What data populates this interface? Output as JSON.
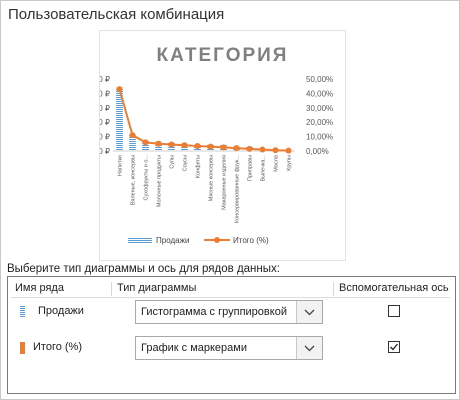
{
  "dialog": {
    "title": "Пользовательская комбинация",
    "instruction": "Выберите тип диаграммы и ось для рядов данных:"
  },
  "chart_data": {
    "type": "bar",
    "title": "КАТЕГОРИЯ",
    "categories": [
      "Напитки",
      "Вяленые, консервы",
      "Сухофрукты и о...",
      "Молочные продукты",
      "Супы",
      "Соусы",
      "Конфеты",
      "Мясные консервы",
      "Макаронные изделия",
      "Консервированные фрук...",
      "Приправы",
      "Выпечка...",
      "Масла",
      "Крупы"
    ],
    "series": [
      {
        "name": "Продажи",
        "type": "bar",
        "axis": "primary",
        "color": "#5b9bd5",
        "values": [
          22000,
          5500,
          3800,
          3300,
          2800,
          2500,
          2400,
          2300,
          2100,
          1800,
          1500,
          700,
          400,
          200
        ]
      },
      {
        "name": "Итого (%)",
        "type": "line",
        "axis": "secondary",
        "color": "#ed7d31",
        "values": [
          43,
          11,
          6,
          5,
          4.5,
          4,
          3.5,
          3,
          2.5,
          2,
          1.5,
          1,
          0.5,
          0.3
        ]
      }
    ],
    "ylim": [
      0,
      25000
    ],
    "y2lim": [
      0,
      50
    ],
    "yticks": [
      "25 000 ₽",
      "20 000 ₽",
      "15 000 ₽",
      "10 000 ₽",
      "5 000 ₽",
      "0 ₽"
    ],
    "y2ticks": [
      "50,00%",
      "40,00%",
      "30,00%",
      "20,00%",
      "10,00%",
      "0,00%"
    ],
    "legend_position": "bottom",
    "grid": false
  },
  "legend": {
    "sales": "Продажи",
    "total": "Итого (%)"
  },
  "series_table": {
    "headers": {
      "name": "Имя ряда",
      "type": "Тип диаграммы",
      "secondary": "Вспомогательная ось"
    },
    "rows": [
      {
        "name": "Продажи",
        "chart_type": "Гистограмма с группировкой",
        "secondary_axis": false,
        "color": "#5b9bd5"
      },
      {
        "name": "Итого (%)",
        "chart_type": "График с маркерами",
        "secondary_axis": true,
        "color": "#ed7d31"
      }
    ]
  },
  "icons": {
    "dropdown": "chevron-down-icon",
    "check": "checkmark-icon"
  }
}
